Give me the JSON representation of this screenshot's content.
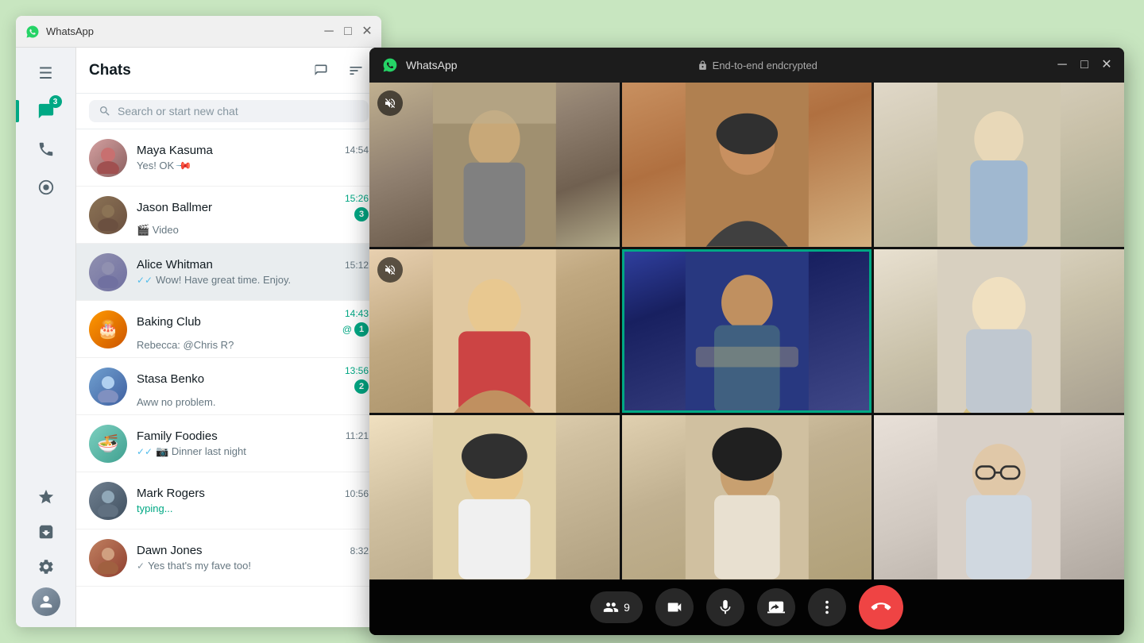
{
  "background_window": {
    "title": "WhatsApp",
    "titlebar": {
      "minimize": "─",
      "maximize": "□",
      "close": "✕"
    }
  },
  "sidebar": {
    "chat_badge": "3",
    "items": [
      {
        "name": "menu",
        "icon": "☰",
        "active": false
      },
      {
        "name": "chats",
        "icon": "💬",
        "active": true,
        "badge": "3"
      },
      {
        "name": "calls",
        "icon": "📞",
        "active": false
      },
      {
        "name": "status",
        "icon": "◎",
        "active": false
      },
      {
        "name": "starred",
        "icon": "★",
        "active": false
      },
      {
        "name": "archived",
        "icon": "🗂",
        "active": false
      },
      {
        "name": "settings",
        "icon": "⚙",
        "active": false
      }
    ]
  },
  "chats": {
    "title": "Chats",
    "new_chat_icon": "✏",
    "filter_icon": "≡",
    "search": {
      "placeholder": "Search or start new chat",
      "icon": "🔍"
    },
    "items": [
      {
        "id": "maya",
        "name": "Maya Kasuma",
        "preview": "Yes! OK",
        "time": "14:54",
        "pinned": true,
        "unread": 0,
        "avatar_class": "avatar-maya"
      },
      {
        "id": "jason",
        "name": "Jason Ballmer",
        "preview": "Video",
        "preview_icon": "🎬",
        "time": "15:26",
        "unread": 3,
        "time_class": "unread",
        "avatar_class": "avatar-jason"
      },
      {
        "id": "alice",
        "name": "Alice Whitman",
        "preview": "Wow! Have great time. Enjoy.",
        "preview_icon": "✓✓",
        "time": "15:12",
        "unread": 0,
        "active": true,
        "avatar_class": "avatar-alice"
      },
      {
        "id": "baking",
        "name": "Baking Club",
        "preview": "Rebecca: @Chris R?",
        "time": "14:43",
        "unread": 1,
        "mention": true,
        "time_class": "unread",
        "avatar_class": "avatar-baking"
      },
      {
        "id": "stasa",
        "name": "Stasa Benko",
        "preview": "Aww no problem.",
        "time": "13:56",
        "unread": 2,
        "time_class": "unread",
        "avatar_class": "avatar-stasa"
      },
      {
        "id": "family",
        "name": "Family Foodies",
        "preview": "Dinner last night",
        "preview_icon": "✓✓ 📷",
        "time": "11:21",
        "unread": 0,
        "avatar_class": "avatar-family"
      },
      {
        "id": "mark",
        "name": "Mark Rogers",
        "preview_typing": "typing...",
        "time": "10:56",
        "unread": 0,
        "avatar_class": "avatar-mark"
      },
      {
        "id": "dawn",
        "name": "Dawn Jones",
        "preview": "Yes that's my fave too!",
        "preview_icon": "✓",
        "time": "8:32",
        "unread": 0,
        "avatar_class": "avatar-dawn"
      }
    ]
  },
  "video_call": {
    "title": "WhatsApp",
    "encryption_label": "End-to-end endcrypted",
    "titlebar": {
      "minimize": "─",
      "maximize": "□",
      "close": "✕"
    },
    "participants_count": "9",
    "controls": {
      "participants": "9",
      "video_icon": "📹",
      "mic_icon": "🎤",
      "share_icon": "⬆",
      "more_icon": "•••",
      "end_call_icon": "📞"
    },
    "cells": [
      {
        "id": 1,
        "muted": true,
        "highlighted": false,
        "bg": "vc1"
      },
      {
        "id": 2,
        "muted": false,
        "highlighted": false,
        "bg": "vc2"
      },
      {
        "id": 3,
        "muted": false,
        "highlighted": false,
        "bg": "vc3"
      },
      {
        "id": 4,
        "muted": true,
        "highlighted": false,
        "bg": "vc4"
      },
      {
        "id": 5,
        "muted": false,
        "highlighted": true,
        "bg": "vc5"
      },
      {
        "id": 6,
        "muted": false,
        "highlighted": false,
        "bg": "vc6"
      },
      {
        "id": 7,
        "muted": false,
        "highlighted": false,
        "bg": "vc7"
      },
      {
        "id": 8,
        "muted": false,
        "highlighted": false,
        "bg": "vc8"
      },
      {
        "id": 9,
        "muted": false,
        "highlighted": false,
        "bg": "vc9"
      }
    ]
  }
}
